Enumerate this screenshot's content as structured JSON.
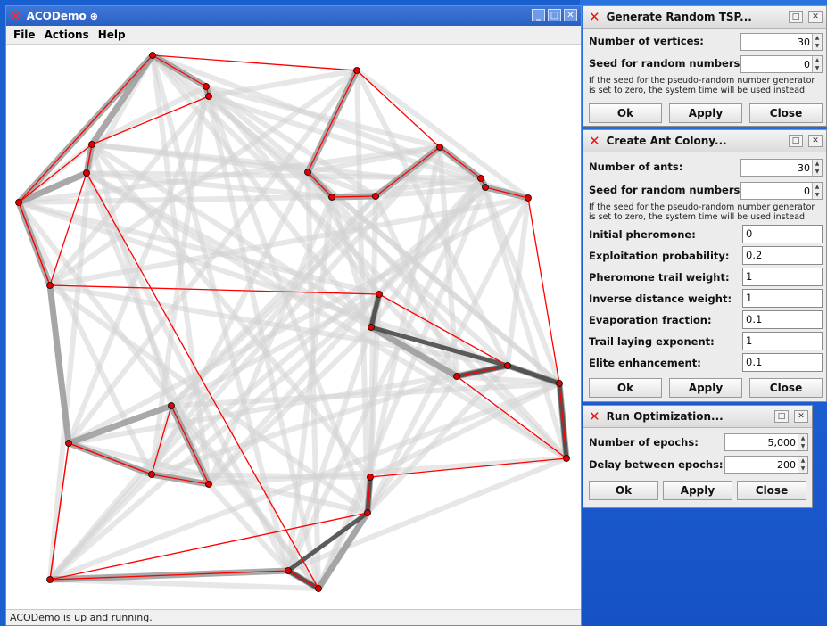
{
  "main_window": {
    "title": "ACODemo",
    "menu": [
      "File",
      "Actions",
      "Help"
    ],
    "status": "ACODemo is up and running."
  },
  "dialog_tsp": {
    "title": "Generate Random TSP...",
    "vertices_label": "Number of vertices:",
    "vertices_value": "30",
    "seed_label": "Seed for random numbers:",
    "seed_value": "0",
    "note": "If the seed for the pseudo-random number generator is set to zero, the system time will be used instead.",
    "ok": "Ok",
    "apply": "Apply",
    "close": "Close"
  },
  "dialog_colony": {
    "title": "Create Ant Colony...",
    "ants_label": "Number of ants:",
    "ants_value": "30",
    "seed_label": "Seed for random numbers:",
    "seed_value": "0",
    "note": "If the seed for the pseudo-random number generator is set to zero, the system time will be used instead.",
    "fields": [
      {
        "label": "Initial pheromone:",
        "value": "0"
      },
      {
        "label": "Exploitation probability:",
        "value": "0.2"
      },
      {
        "label": "Pheromone trail weight:",
        "value": "1"
      },
      {
        "label": "Inverse distance weight:",
        "value": "1"
      },
      {
        "label": "Evaporation fraction:",
        "value": "0.1"
      },
      {
        "label": "Trail laying exponent:",
        "value": "1"
      },
      {
        "label": "Elite enhancement:",
        "value": "0.1"
      }
    ],
    "ok": "Ok",
    "apply": "Apply",
    "close": "Close"
  },
  "dialog_run": {
    "title": "Run Optimization...",
    "epochs_label": "Number of epochs:",
    "epochs_value": "5,000",
    "delay_label": "Delay between epochs:",
    "delay_value": "200",
    "ok": "Ok",
    "apply": "Apply",
    "close": "Close"
  },
  "colors": {
    "tour": "#ff0000",
    "vertex": "#e00000",
    "trail": "#9a9a9a"
  }
}
